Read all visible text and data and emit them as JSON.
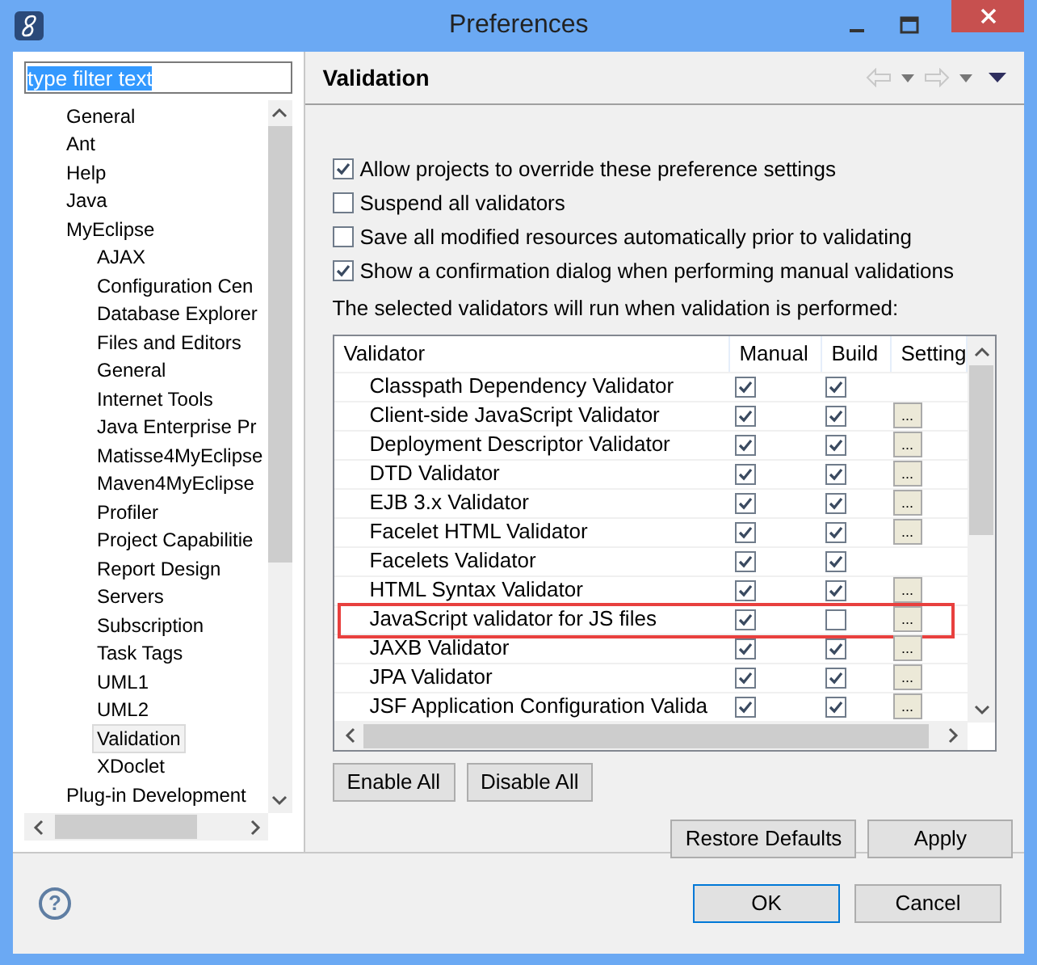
{
  "window": {
    "title": "Preferences"
  },
  "filter": {
    "value": "type filter text",
    "selected": true
  },
  "tree": [
    {
      "label": "General",
      "selected": false
    },
    {
      "label": "Ant",
      "selected": false
    },
    {
      "label": "Help",
      "selected": false
    },
    {
      "label": "Java",
      "selected": false
    },
    {
      "label": "MyEclipse",
      "selected": false,
      "children": [
        {
          "label": "AJAX",
          "selected": false
        },
        {
          "label": "Configuration Cen",
          "selected": false
        },
        {
          "label": "Database Explorer",
          "selected": false
        },
        {
          "label": "Files and Editors",
          "selected": false
        },
        {
          "label": "General",
          "selected": false
        },
        {
          "label": "Internet Tools",
          "selected": false
        },
        {
          "label": "Java Enterprise Pr",
          "selected": false
        },
        {
          "label": "Matisse4MyEclipse",
          "selected": false
        },
        {
          "label": "Maven4MyEclipse",
          "selected": false
        },
        {
          "label": "Profiler",
          "selected": false
        },
        {
          "label": "Project Capabilitie",
          "selected": false
        },
        {
          "label": "Report Design",
          "selected": false
        },
        {
          "label": "Servers",
          "selected": false
        },
        {
          "label": "Subscription",
          "selected": false
        },
        {
          "label": "Task Tags",
          "selected": false
        },
        {
          "label": "UML1",
          "selected": false
        },
        {
          "label": "UML2",
          "selected": false
        },
        {
          "label": "Validation",
          "selected": true
        },
        {
          "label": "XDoclet",
          "selected": false
        }
      ]
    },
    {
      "label": "Plug-in Development",
      "selected": false
    }
  ],
  "page": {
    "title": "Validation",
    "options": [
      {
        "label": "Allow projects to override these preference settings",
        "checked": true
      },
      {
        "label": "Suspend all validators",
        "checked": false
      },
      {
        "label": "Save all modified resources automatically prior to validating",
        "checked": false
      },
      {
        "label": "Show a confirmation dialog when performing manual validations",
        "checked": true
      }
    ],
    "note": "The selected validators will run when validation is performed:",
    "table": {
      "columns": [
        "Validator",
        "Manual",
        "Build",
        "Setting"
      ],
      "rows": [
        {
          "name": "Classpath Dependency Validator",
          "manual": true,
          "build": true,
          "settings": false,
          "highlighted": false
        },
        {
          "name": "Client-side JavaScript Validator",
          "manual": true,
          "build": true,
          "settings": true,
          "highlighted": false
        },
        {
          "name": "Deployment Descriptor Validator",
          "manual": true,
          "build": true,
          "settings": true,
          "highlighted": false
        },
        {
          "name": "DTD Validator",
          "manual": true,
          "build": true,
          "settings": true,
          "highlighted": false
        },
        {
          "name": "EJB 3.x Validator",
          "manual": true,
          "build": true,
          "settings": true,
          "highlighted": false
        },
        {
          "name": "Facelet HTML Validator",
          "manual": true,
          "build": true,
          "settings": true,
          "highlighted": false
        },
        {
          "name": "Facelets Validator",
          "manual": true,
          "build": true,
          "settings": false,
          "highlighted": false
        },
        {
          "name": "HTML Syntax Validator",
          "manual": true,
          "build": true,
          "settings": true,
          "highlighted": false
        },
        {
          "name": "JavaScript validator for JS files",
          "manual": true,
          "build": false,
          "settings": true,
          "highlighted": true
        },
        {
          "name": "JAXB Validator",
          "manual": true,
          "build": true,
          "settings": true,
          "highlighted": false
        },
        {
          "name": "JPA Validator",
          "manual": true,
          "build": true,
          "settings": true,
          "highlighted": false
        },
        {
          "name": "JSF Application Configuration Valida",
          "manual": true,
          "build": true,
          "settings": true,
          "highlighted": false
        }
      ],
      "settings_label": "..."
    },
    "buttons": [
      "Enable All",
      "Disable All"
    ],
    "actions": [
      "Restore Defaults",
      "Apply"
    ]
  },
  "footer": {
    "help": "?",
    "buttons": [
      {
        "label": "OK",
        "default": true
      },
      {
        "label": "Cancel",
        "default": false
      }
    ]
  }
}
